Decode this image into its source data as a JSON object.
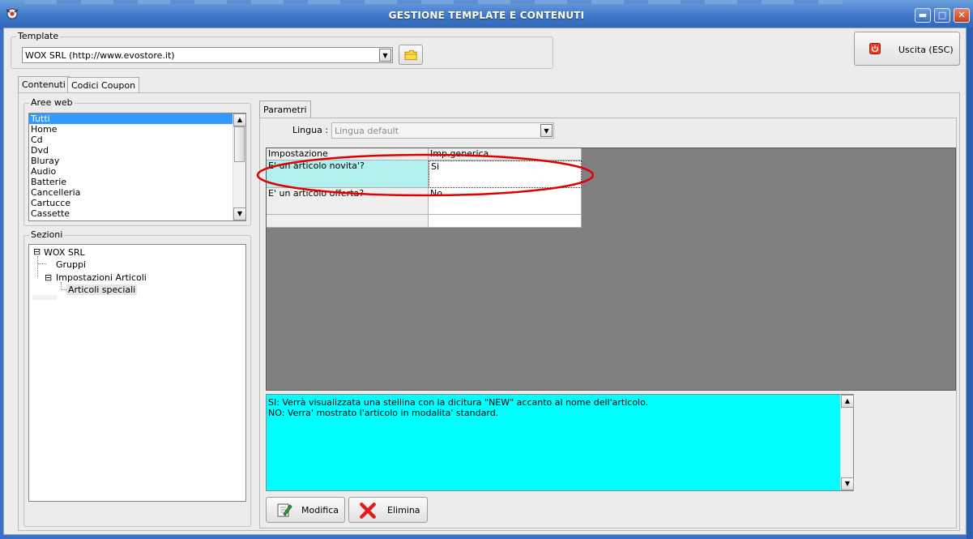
{
  "window": {
    "title": "GESTIONE TEMPLATE E CONTENUTI"
  },
  "template": {
    "caption": "Template",
    "selected": "WOX SRL (http://www.evostore.it)"
  },
  "exit_button": {
    "label": "Uscita (ESC)"
  },
  "tabs": [
    {
      "label": "Contenuti"
    },
    {
      "label": "Codici Coupon"
    }
  ],
  "aree_web": {
    "caption": "Aree web",
    "items": [
      "Tutti",
      "Home",
      "Cd",
      "Dvd",
      "Bluray",
      "Audio",
      "Batterie",
      "Cancelleria",
      "Cartucce",
      "Cassette"
    ],
    "selected_index": 0
  },
  "sezioni": {
    "caption": "Sezioni",
    "nodes": {
      "root": "WOX SRL",
      "gruppi": "Gruppi",
      "impostazioni": "Impostazioni Articoli",
      "speciali": "Articoli speciali"
    }
  },
  "parametri": {
    "tab_label": "Parametri",
    "lingua_label": "Lingua :",
    "lingua_value": "Lingua default",
    "columns": [
      "Impostazione",
      "Imp.generica"
    ],
    "rows": [
      {
        "setting": "E' un articolo novita'?",
        "value": "Si"
      },
      {
        "setting": "E' un articolo offerta?",
        "value": "No"
      }
    ],
    "description": [
      "SI: Verrà visualizzata una stellina con la dicitura \"NEW\" accanto al nome dell'articolo.",
      "NO: Verra' mostrato l'articolo in modalita' standard."
    ]
  },
  "actions": {
    "modifica": "Modifica",
    "elimina": "Elimina"
  },
  "colors": {
    "selection": "#3399ff",
    "description_bg": "#00ffff",
    "highlight_cell": "#b2f0ef",
    "annotation": "#e00000"
  }
}
